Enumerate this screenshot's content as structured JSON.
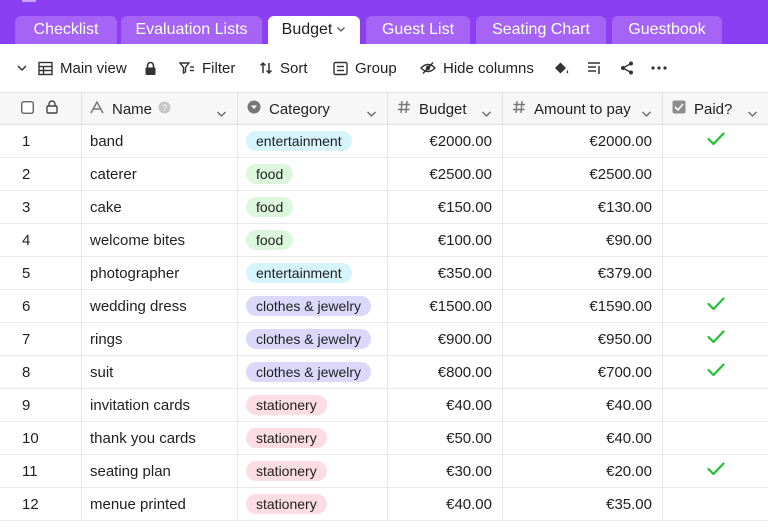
{
  "tabs": [
    {
      "label": "Checklist",
      "active": false
    },
    {
      "label": "Evaluation Lists",
      "active": false
    },
    {
      "label": "Budget",
      "active": true
    },
    {
      "label": "Guest List",
      "active": false
    },
    {
      "label": "Seating Chart",
      "active": false
    },
    {
      "label": "Guestbook",
      "active": false
    }
  ],
  "toolbar": {
    "view_label": "Main view",
    "filter_label": "Filter",
    "sort_label": "Sort",
    "group_label": "Group",
    "hide_columns_label": "Hide columns"
  },
  "columns": {
    "name": "Name",
    "category": "Category",
    "budget": "Budget",
    "amount": "Amount to pay",
    "paid": "Paid?"
  },
  "category_colors": {
    "entertainment": "#d6f4fb",
    "food": "#dcf7dc",
    "clothes & jewelry": "#dcd8fb",
    "stationery": "#fbdde3"
  },
  "accent_color": "#8a3ff2",
  "check_color": "#22c032",
  "rows": [
    {
      "num": "1",
      "name": "band",
      "category": "entertainment",
      "budget": "€2000.00",
      "amount": "€2000.00",
      "paid": true
    },
    {
      "num": "2",
      "name": "caterer",
      "category": "food",
      "budget": "€2500.00",
      "amount": "€2500.00",
      "paid": false
    },
    {
      "num": "3",
      "name": "cake",
      "category": "food",
      "budget": "€150.00",
      "amount": "€130.00",
      "paid": false
    },
    {
      "num": "4",
      "name": "welcome bites",
      "category": "food",
      "budget": "€100.00",
      "amount": "€90.00",
      "paid": false
    },
    {
      "num": "5",
      "name": "photographer",
      "category": "entertainment",
      "budget": "€350.00",
      "amount": "€379.00",
      "paid": false
    },
    {
      "num": "6",
      "name": "wedding dress",
      "category": "clothes & jewelry",
      "budget": "€1500.00",
      "amount": "€1590.00",
      "paid": true
    },
    {
      "num": "7",
      "name": "rings",
      "category": "clothes & jewelry",
      "budget": "€900.00",
      "amount": "€950.00",
      "paid": true
    },
    {
      "num": "8",
      "name": "suit",
      "category": "clothes & jewelry",
      "budget": "€800.00",
      "amount": "€700.00",
      "paid": true
    },
    {
      "num": "9",
      "name": "invitation cards",
      "category": "stationery",
      "budget": "€40.00",
      "amount": "€40.00",
      "paid": false
    },
    {
      "num": "10",
      "name": "thank you cards",
      "category": "stationery",
      "budget": "€50.00",
      "amount": "€40.00",
      "paid": false
    },
    {
      "num": "11",
      "name": "seating plan",
      "category": "stationery",
      "budget": "€30.00",
      "amount": "€20.00",
      "paid": true
    },
    {
      "num": "12",
      "name": "menue printed",
      "category": "stationery",
      "budget": "€40.00",
      "amount": "€35.00",
      "paid": false
    }
  ]
}
